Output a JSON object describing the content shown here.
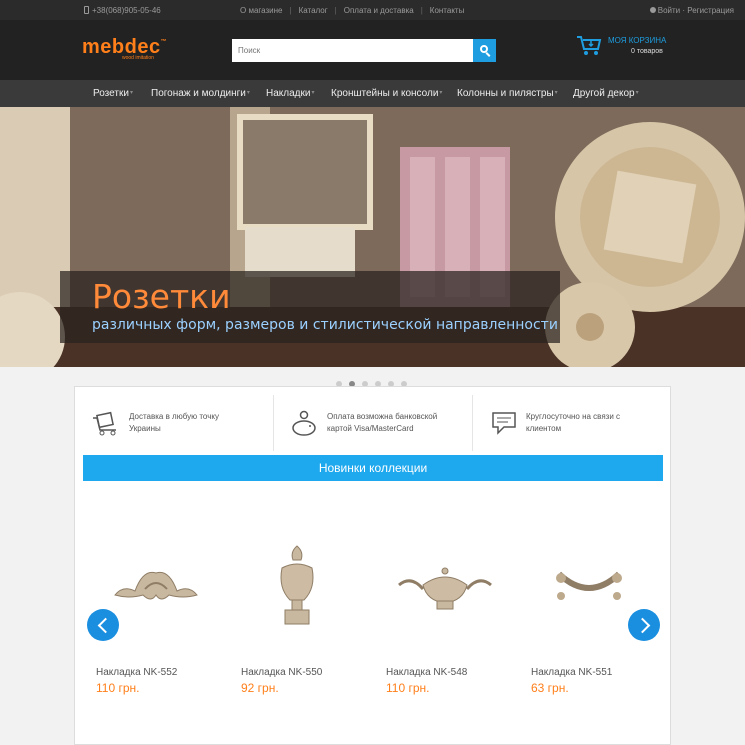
{
  "topbar": {
    "phone": "+38(068)905-05-46",
    "links": [
      "О магазине",
      "Каталог",
      "Оплата и доставка",
      "Контакты"
    ],
    "login": "Войти",
    "register": "Регистрация"
  },
  "header": {
    "logo": "mebdec",
    "logo_tm": "™",
    "logo_sub": "wood imitation",
    "search_placeholder": "Поиск",
    "cart_title": "МОЯ КОРЗИНА",
    "cart_count": "0 товаров"
  },
  "nav": {
    "items": [
      "Розетки",
      "Погонаж и молдинги",
      "Накладки",
      "Кронштейны и консоли",
      "Колонны и пилястры",
      "Другой декор"
    ]
  },
  "banner": {
    "title": "Розетки",
    "subtitle": "различных форм, размеров и стилистической направленности",
    "slides": 6,
    "active_slide": 2
  },
  "features": [
    {
      "icon": "delivery-cart-icon",
      "text1": "Доставка в любую точку",
      "text2": "Украины"
    },
    {
      "icon": "piggy-bank-icon",
      "text1": "Оплата возможна банковской",
      "text2": "картой Visa/MasterCard"
    },
    {
      "icon": "chat-bubble-icon",
      "text1": "Круглосуточно на связи с",
      "text2": "клиентом"
    }
  ],
  "section_title": "Новинки коллекции",
  "products": [
    {
      "name": "Накладка NK-552",
      "price": "110 грн."
    },
    {
      "name": "Накладка NK-550",
      "price": "92 грн."
    },
    {
      "name": "Накладка NK-548",
      "price": "110 грн."
    },
    {
      "name": "Накладка NK-551",
      "price": "63 грн."
    }
  ],
  "colors": {
    "accent_orange": "#ff7f1a",
    "accent_blue": "#1ea8ee"
  }
}
